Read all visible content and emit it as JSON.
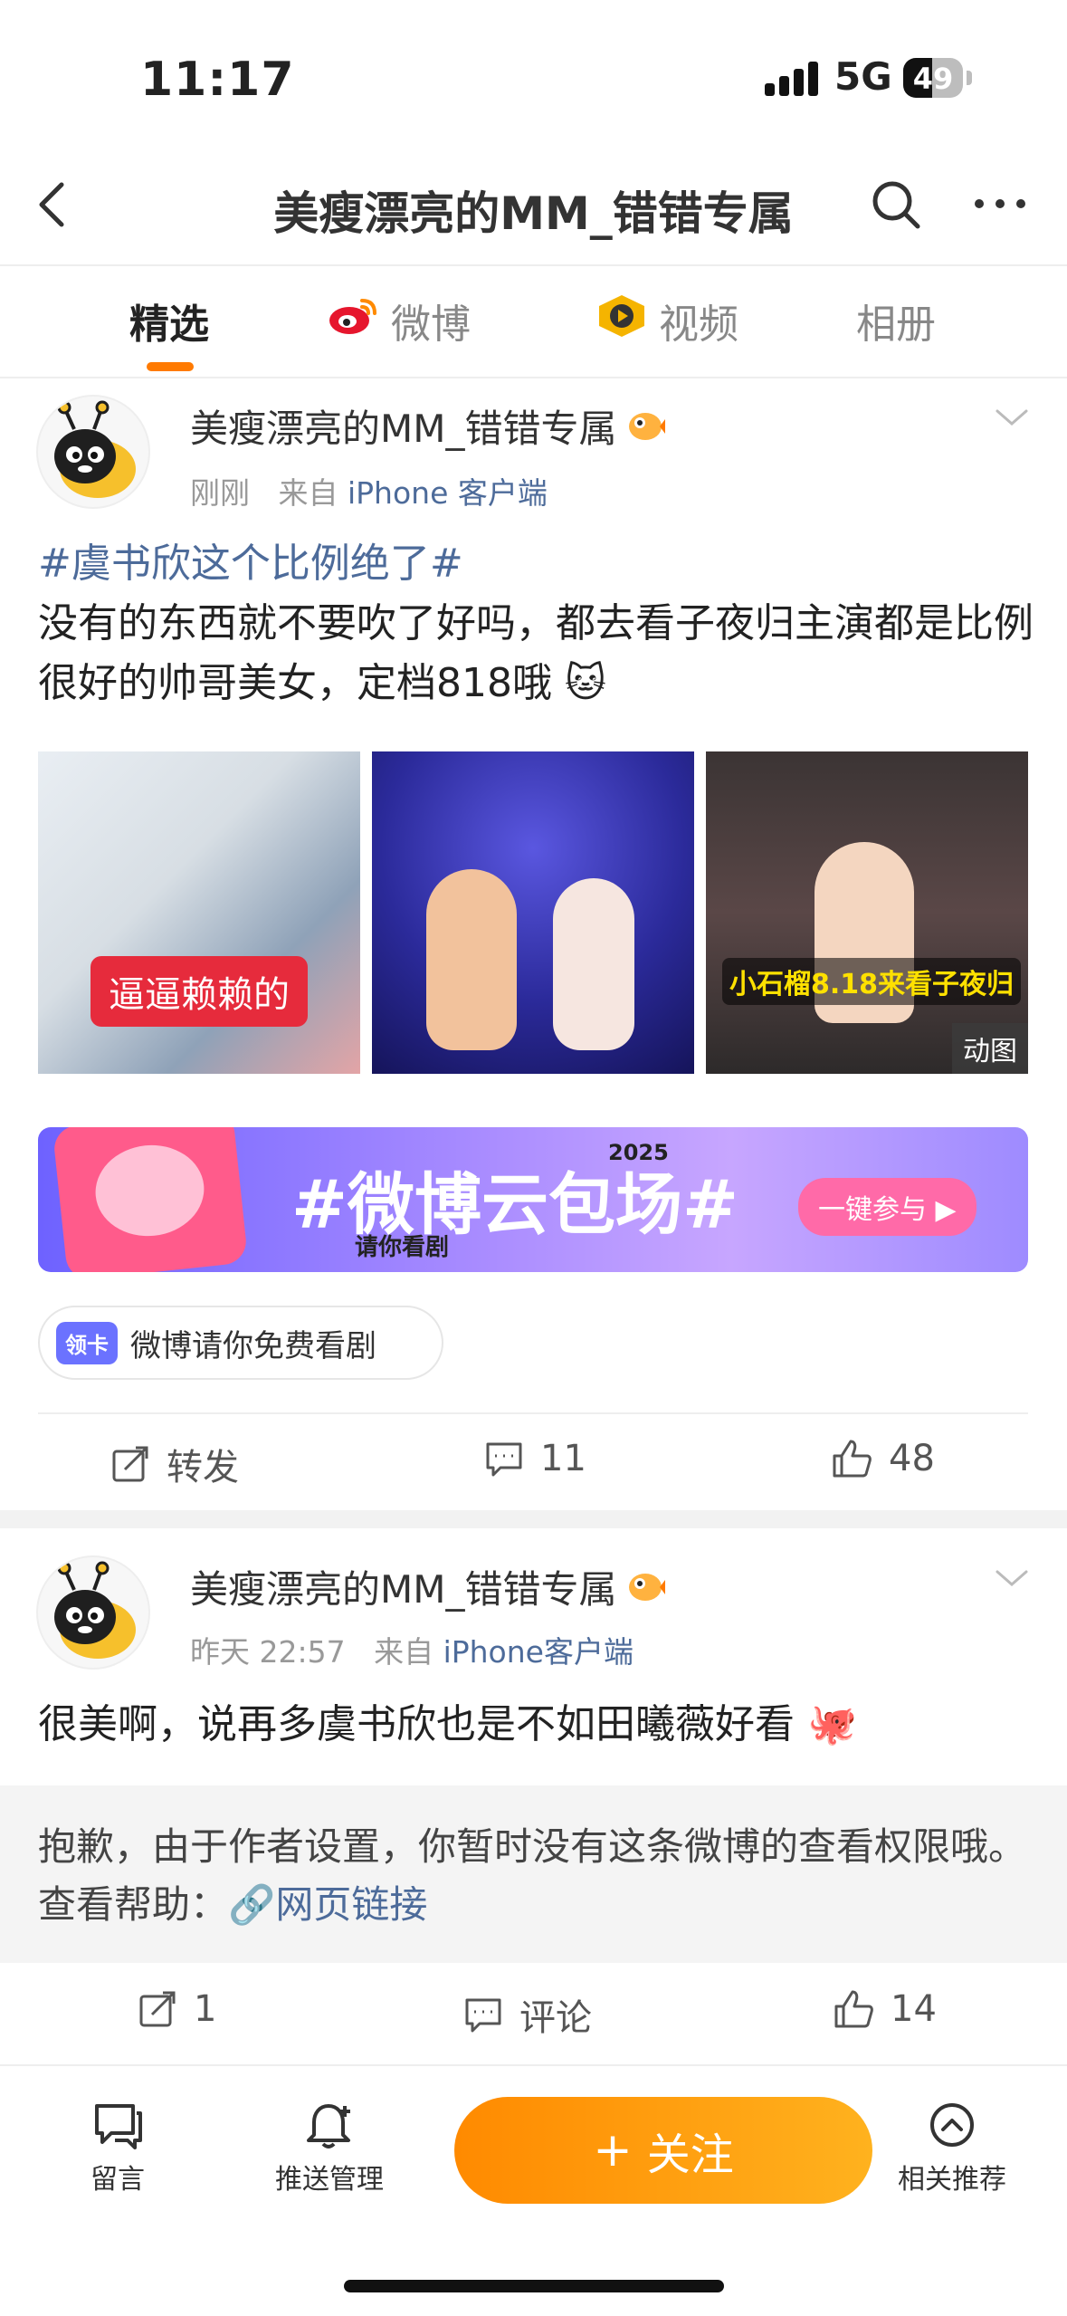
{
  "status_bar": {
    "time": "11:17",
    "network": "5G",
    "battery": "49",
    "battery_level": 0.49
  },
  "nav": {
    "title": "美瘦漂亮的MM_错错专属"
  },
  "tabs": [
    {
      "label": "精选"
    },
    {
      "label": "微博"
    },
    {
      "label": "视频"
    },
    {
      "label": "相册"
    }
  ],
  "post1": {
    "username": "美瘦漂亮的MM_错错专属",
    "time": "刚刚",
    "source_prefix": "来自",
    "source": "iPhone 客户端",
    "hashtag": "#虞书欣这个比例绝了#",
    "text": "没有的东西就不要吹了好吗，都去看子夜归主演都是比例很好的帅哥美女，定档818哦",
    "images": [
      {
        "caption": "逼逼赖赖的"
      },
      {
        "caption": ""
      },
      {
        "caption": "小石榴8.18来看子夜归",
        "badge": "动图"
      }
    ],
    "banner": {
      "title": "#微博云包场#",
      "year": "2025",
      "subtitle": "请你看剧",
      "cta": "一键参与 ▶"
    },
    "pill": {
      "tag": "领卡",
      "text": "微博请你免费看剧"
    },
    "actions": {
      "repost": "转发",
      "comments": "11",
      "likes": "48"
    }
  },
  "post2": {
    "username": "美瘦漂亮的MM_错错专属",
    "time": "昨天 22:57",
    "source_prefix": "来自",
    "source": "iPhone客户端",
    "text": "很美啊，说再多虞书欣也是不如田曦薇好看",
    "notice": "抱歉，由于作者设置，你暂时没有这条微博的查看权限哦。查看帮助：",
    "notice_link": "网页链接",
    "actions": {
      "repost": "1",
      "comment": "评论",
      "likes": "14"
    }
  },
  "bottom_bar": {
    "message": "留言",
    "push": "推送管理",
    "follow": "关注",
    "recommend": "相关推荐"
  },
  "colors": {
    "accent": "#ff7a00",
    "link": "#4d6b9a"
  },
  "icons": [
    "back-icon",
    "search-icon",
    "more-icon",
    "weibo-icon",
    "video-icon",
    "chevron-down-icon",
    "repost-icon",
    "comment-icon",
    "like-icon",
    "message-icon",
    "bell-icon",
    "recommend-icon",
    "link-icon"
  ]
}
